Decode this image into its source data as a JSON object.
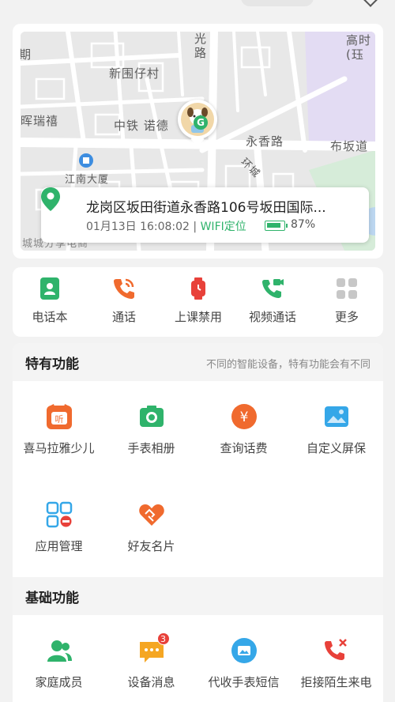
{
  "map": {
    "labels": {
      "top_left": "期",
      "guang_lu": "光\n路",
      "top_right": "高时\n(珏",
      "xinweizai": "新围仔村",
      "huiruixi": "晖瑞禧",
      "zhongtie": "中铁 诺德",
      "yongxiang": "永香路",
      "bubandao": "布坂道",
      "jiangnan": "江南大厦",
      "huancheng": "环城",
      "bottom": "城城分享电商"
    },
    "location": {
      "address": "龙岗区坂田街道永香路106号坂田国际...",
      "datetime": "01月13日 16:08:02",
      "separator": "|",
      "method": "WIFI定位",
      "battery_percent": 87,
      "battery_label": "87%"
    }
  },
  "quick_actions": [
    {
      "label": "电话本",
      "icon": "phonebook-icon"
    },
    {
      "label": "通话",
      "icon": "call-icon"
    },
    {
      "label": "上课禁用",
      "icon": "class-mode-icon"
    },
    {
      "label": "视频通话",
      "icon": "video-call-icon"
    },
    {
      "label": "更多",
      "icon": "more-icon"
    }
  ],
  "special": {
    "title": "特有功能",
    "subtitle": "不同的智能设备，特有功能会有不同",
    "items": [
      {
        "label": "喜马拉雅少儿",
        "icon": "ximalaya-icon"
      },
      {
        "label": "手表相册",
        "icon": "camera-icon"
      },
      {
        "label": "查询话费",
        "icon": "yen-icon"
      },
      {
        "label": "自定义屏保",
        "icon": "screensaver-icon"
      },
      {
        "label": "应用管理",
        "icon": "app-manage-icon"
      },
      {
        "label": "好友名片",
        "icon": "friend-card-icon"
      }
    ]
  },
  "basic": {
    "title": "基础功能",
    "items": [
      {
        "label": "家庭成员",
        "icon": "family-icon"
      },
      {
        "label": "设备消息",
        "icon": "message-icon",
        "badge": "3"
      },
      {
        "label": "代收手表短信",
        "icon": "sms-icon"
      },
      {
        "label": "拒接陌生来电",
        "icon": "reject-call-icon"
      }
    ]
  },
  "colors": {
    "green": "#2fb36b",
    "orange": "#f06a2e",
    "red": "#e8413a",
    "blue": "#35a7e8"
  }
}
